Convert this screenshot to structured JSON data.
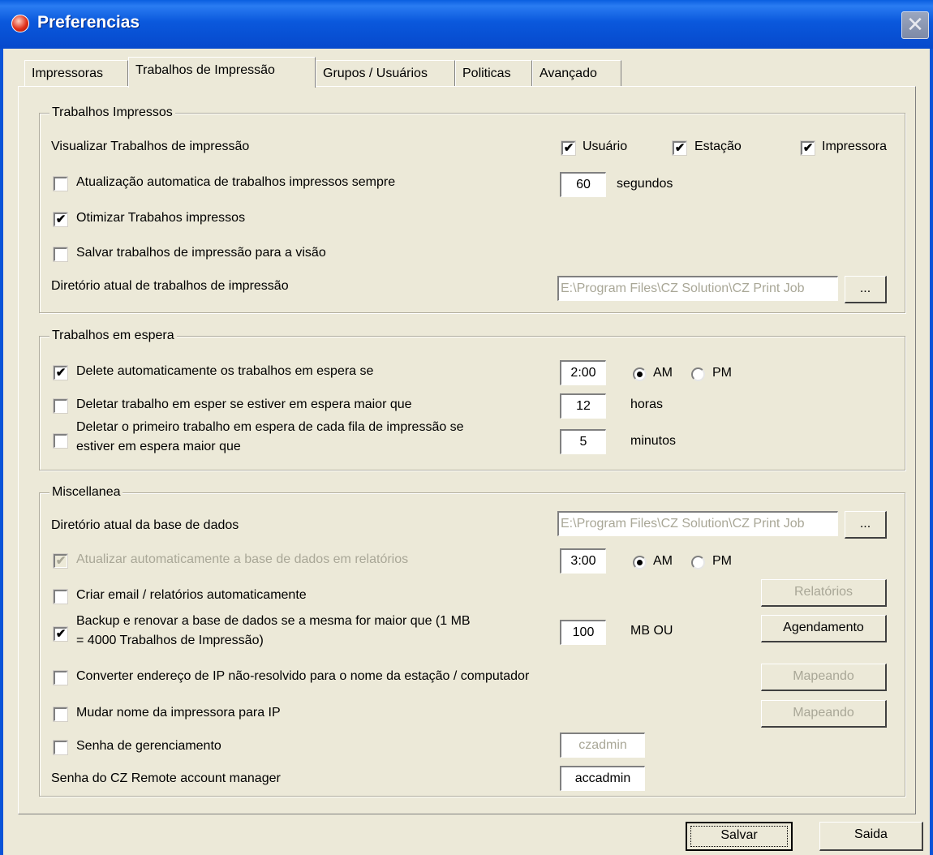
{
  "window": {
    "title": "Preferencias"
  },
  "tabs": [
    {
      "label": "Impressoras"
    },
    {
      "label": "Trabalhos de Impressão"
    },
    {
      "label": "Grupos / Usuários"
    },
    {
      "label": "Politicas"
    },
    {
      "label": "Avançado"
    }
  ],
  "printed_jobs": {
    "legend": "Trabalhos Impressos",
    "view_label": "Visualizar Trabalhos de impressão",
    "view_user": {
      "label": "Usuário",
      "checked": true
    },
    "view_station": {
      "label": "Estação",
      "checked": true
    },
    "view_printer": {
      "label": "Impressora",
      "checked": true
    },
    "auto_update": {
      "label": "Atualização automatica de trabalhos impressos sempre",
      "checked": false
    },
    "auto_update_value": "60",
    "auto_update_unit": "segundos",
    "optimize": {
      "label": "Otimizar Trabahos impressos",
      "checked": true
    },
    "save_jobs": {
      "label": "Salvar trabalhos de impressão para a visão",
      "checked": false
    },
    "dir_label": "Diretório atual de trabalhos de impressão",
    "dir_value": "E:\\Program Files\\CZ Solution\\CZ Print Job",
    "browse_label": "..."
  },
  "held_jobs": {
    "legend": "Trabalhos em espera",
    "auto_delete": {
      "label": "Delete automaticamente os trabalhos em espera se",
      "checked": true
    },
    "auto_delete_time": "2:00",
    "am_label": "AM",
    "pm_label": "PM",
    "ampm_selected": "AM",
    "delete_older": {
      "label": "Deletar trabalho em esper se estiver em espera maior que",
      "checked": false
    },
    "delete_older_value": "12",
    "delete_older_unit": "horas",
    "delete_first_line1": "Deletar o primeiro trabalho em espera de cada fila de impressão se",
    "delete_first_line2": "estiver em espera maior que",
    "delete_first_checked": false,
    "delete_first_value": "5",
    "delete_first_unit": "minutos"
  },
  "misc": {
    "legend": "Miscellanea",
    "db_dir_label": "Diretório atual da base de dados",
    "db_dir_value": "E:\\Program Files\\CZ Solution\\CZ Print Job",
    "browse_label": "...",
    "auto_update_db": {
      "label": "Atualizar automaticamente a base de dados em relatórios",
      "checked": true,
      "disabled": true
    },
    "auto_update_db_time": "3:00",
    "am_label": "AM",
    "pm_label": "PM",
    "ampm_selected": "AM",
    "create_email": {
      "label": "Criar email / relatórios automaticamente",
      "checked": false
    },
    "reports_button": "Relatórios",
    "backup_line1": "Backup e renovar a base de dados se a mesma for maior que (1 MB",
    "backup_line2": "= 4000 Trabalhos de Impressão)",
    "backup_checked": true,
    "backup_value": "100",
    "backup_unit": "MB  OU",
    "schedule_button": "Agendamento",
    "convert_ip": {
      "label": "Converter endereço de IP não-resolvido para o nome da estação / computador",
      "checked": false
    },
    "mapping_button_1": "Mapeando",
    "rename_printer": {
      "label": "Mudar nome da impressora para IP",
      "checked": false
    },
    "mapping_button_2": "Mapeando",
    "mgmt_password": {
      "label": "Senha de gerenciamento",
      "checked": false
    },
    "mgmt_password_value": "czadmin",
    "remote_label": "Senha do CZ Remote account manager",
    "remote_value": "accadmin"
  },
  "footer": {
    "save_label": "Salvar",
    "exit_label": "Saida"
  },
  "icons": {
    "check": "✔",
    "close": "✕"
  }
}
